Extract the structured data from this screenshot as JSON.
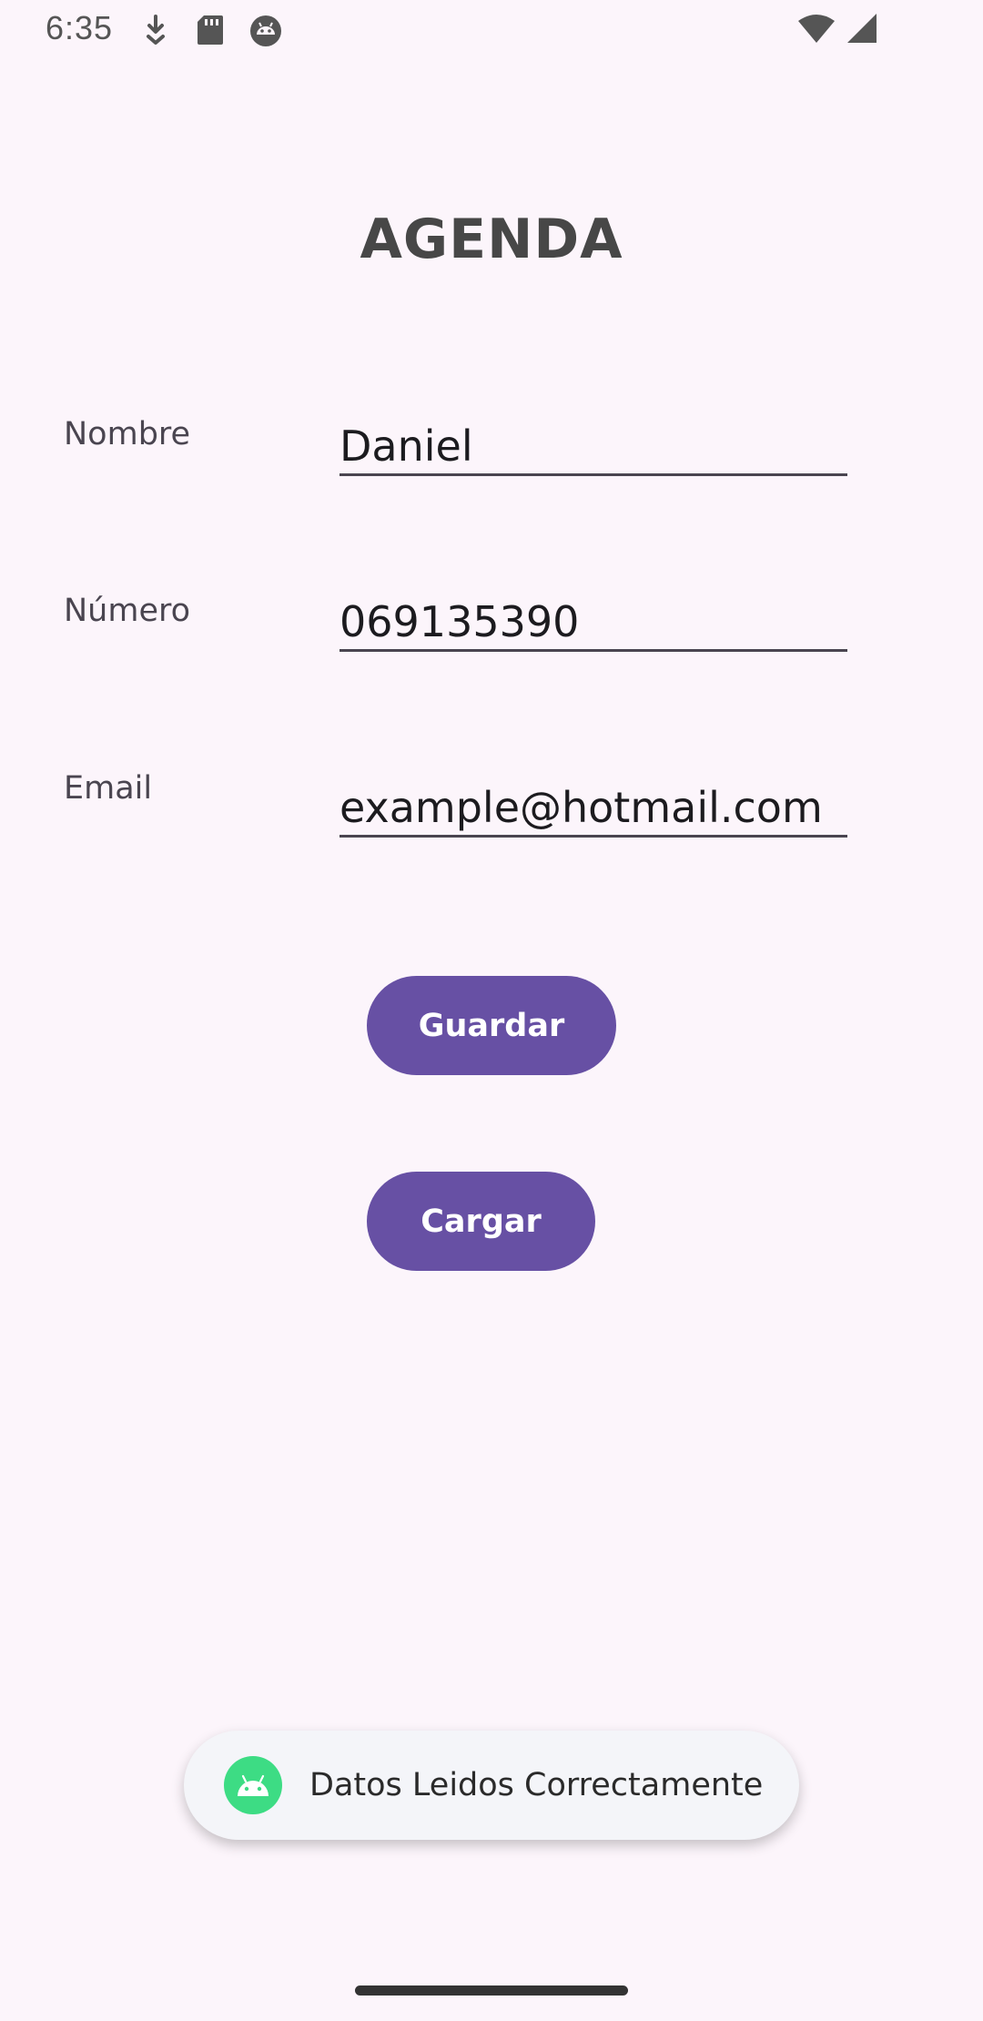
{
  "status_bar": {
    "time": "6:35",
    "icons_left": [
      "download-icon",
      "sd-card-icon",
      "android-debug-icon"
    ],
    "icons_right": [
      "wifi-icon",
      "cell-signal-icon"
    ]
  },
  "app": {
    "title": "AGENDA"
  },
  "form": {
    "name": {
      "label": "Nombre",
      "value": "Daniel"
    },
    "number": {
      "label": "Número",
      "value": "069135390"
    },
    "email": {
      "label": "Email",
      "value": "example@hotmail.com"
    }
  },
  "buttons": {
    "save": "Guardar",
    "load": "Cargar"
  },
  "toast": {
    "icon": "android-icon",
    "message": "Datos Leidos Correctamente"
  },
  "colors": {
    "background": "#FCF5FB",
    "primary": "#6750A4",
    "toast_icon": "#3DDC84"
  }
}
